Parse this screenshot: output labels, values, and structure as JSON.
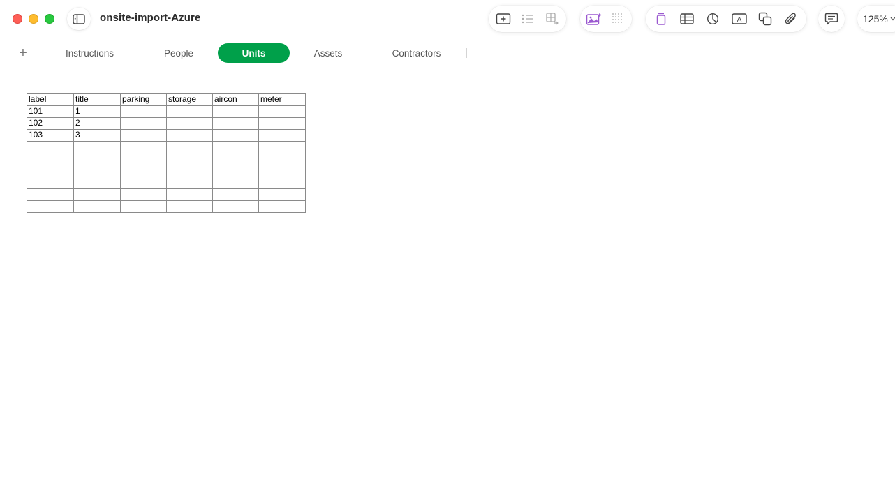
{
  "window": {
    "title": "onsite-import-Azure"
  },
  "toolbar": {
    "insert_group": [
      "add-element-icon",
      "list-icon",
      "table-grid-icon"
    ],
    "media_group": [
      "image-sparkle-icon",
      "dots-grid-icon"
    ],
    "object_group": [
      "shape-cylinder-icon",
      "table-icon",
      "chart-icon",
      "text-box-icon",
      "shapes-icon",
      "paperclip-icon"
    ],
    "comment_icon": "comment-icon",
    "zoom_label": "125%",
    "accent_color": "#9b59d0"
  },
  "tabs": {
    "add_label": "+",
    "items": [
      {
        "label": "Instructions",
        "active": false
      },
      {
        "label": "People",
        "active": false
      },
      {
        "label": "Units",
        "active": true
      },
      {
        "label": "Assets",
        "active": false
      },
      {
        "label": "Contractors",
        "active": false
      }
    ],
    "active_color": "#00a04a"
  },
  "table": {
    "headers": [
      "label",
      "title",
      "parking",
      "storage",
      "aircon",
      "meter"
    ],
    "rows": [
      [
        "101",
        "1",
        "",
        "",
        "",
        ""
      ],
      [
        "102",
        "2",
        "",
        "",
        "",
        ""
      ],
      [
        "103",
        "3",
        "",
        "",
        "",
        ""
      ],
      [
        "",
        "",
        "",
        "",
        "",
        ""
      ],
      [
        "",
        "",
        "",
        "",
        "",
        ""
      ],
      [
        "",
        "",
        "",
        "",
        "",
        ""
      ],
      [
        "",
        "",
        "",
        "",
        "",
        ""
      ],
      [
        "",
        "",
        "",
        "",
        "",
        ""
      ],
      [
        "",
        "",
        "",
        "",
        "",
        ""
      ]
    ]
  }
}
